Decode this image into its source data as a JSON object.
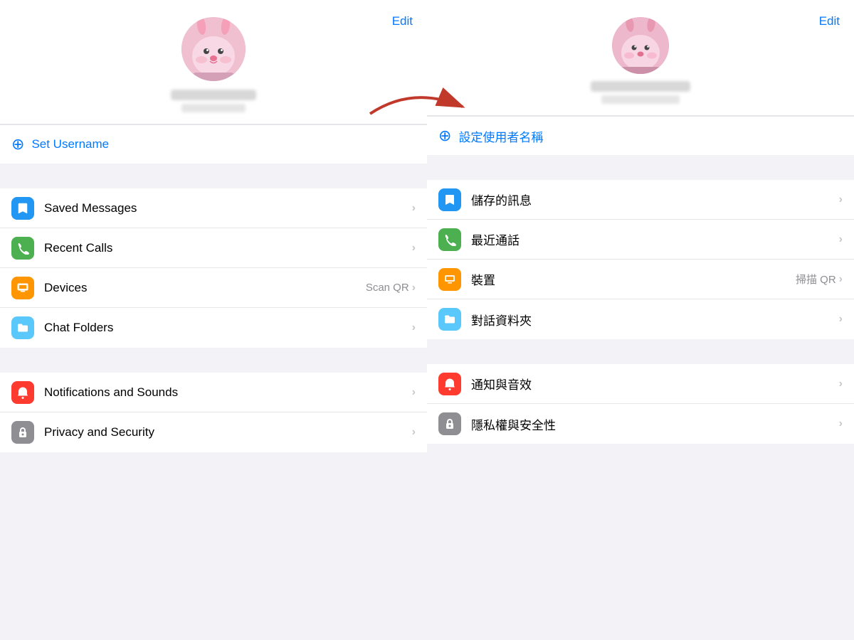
{
  "left": {
    "edit_label": "Edit",
    "avatar_alt": "Bunny avatar",
    "set_username_label": "Set Username",
    "menu_items": [
      {
        "id": "saved-messages",
        "icon": "bookmark",
        "icon_class": "icon-blue",
        "label": "Saved Messages",
        "chevron": "›"
      },
      {
        "id": "recent-calls",
        "icon": "phone",
        "icon_class": "icon-green",
        "label": "Recent Calls",
        "chevron": "›"
      },
      {
        "id": "devices",
        "icon": "laptop",
        "icon_class": "icon-orange",
        "label": "Devices",
        "extra": "Scan QR",
        "chevron": "›"
      },
      {
        "id": "chat-folders",
        "icon": "folder",
        "icon_class": "icon-cyan",
        "label": "Chat Folders",
        "chevron": "›"
      }
    ],
    "notifications_label": "Notifications and Sounds",
    "notifications_icon": "bell",
    "notifications_icon_class": "icon-red",
    "notifications_chevron": "›",
    "privacy_label": "Privacy and Security",
    "privacy_icon": "lock",
    "privacy_icon_class": "icon-gray",
    "privacy_chevron": "›"
  },
  "right": {
    "edit_label": "Edit",
    "avatar_alt": "Bunny avatar",
    "set_username_label": "設定使用者名稱",
    "menu_items": [
      {
        "id": "saved-messages-zh",
        "icon": "bookmark",
        "icon_class": "icon-blue",
        "label": "儲存的訊息",
        "chevron": "›"
      },
      {
        "id": "recent-calls-zh",
        "icon": "phone",
        "icon_class": "icon-green",
        "label": "最近通話",
        "chevron": "›"
      },
      {
        "id": "devices-zh",
        "icon": "laptop",
        "icon_class": "icon-orange",
        "label": "裝置",
        "extra": "掃描 QR",
        "chevron": "›"
      },
      {
        "id": "chat-folders-zh",
        "icon": "folder",
        "icon_class": "icon-cyan",
        "label": "對話資料夾",
        "chevron": "›"
      }
    ],
    "notifications_label": "通知與音效",
    "notifications_icon": "bell",
    "notifications_icon_class": "icon-red",
    "notifications_chevron": "›",
    "privacy_label": "隱私權與安全性",
    "privacy_icon": "lock",
    "privacy_icon_class": "icon-gray",
    "privacy_chevron": "›"
  },
  "icons": {
    "bookmark": "🔖",
    "phone": "📞",
    "laptop": "💻",
    "folder": "📁",
    "bell": "🔔",
    "lock": "🔒",
    "user_circle": "⊕",
    "chevron": "›"
  },
  "colors": {
    "blue": "#007aff",
    "green": "#4caf50",
    "orange": "#ff9500",
    "cyan": "#5ac8fa",
    "red": "#ff3b30",
    "gray": "#8e8e93"
  }
}
